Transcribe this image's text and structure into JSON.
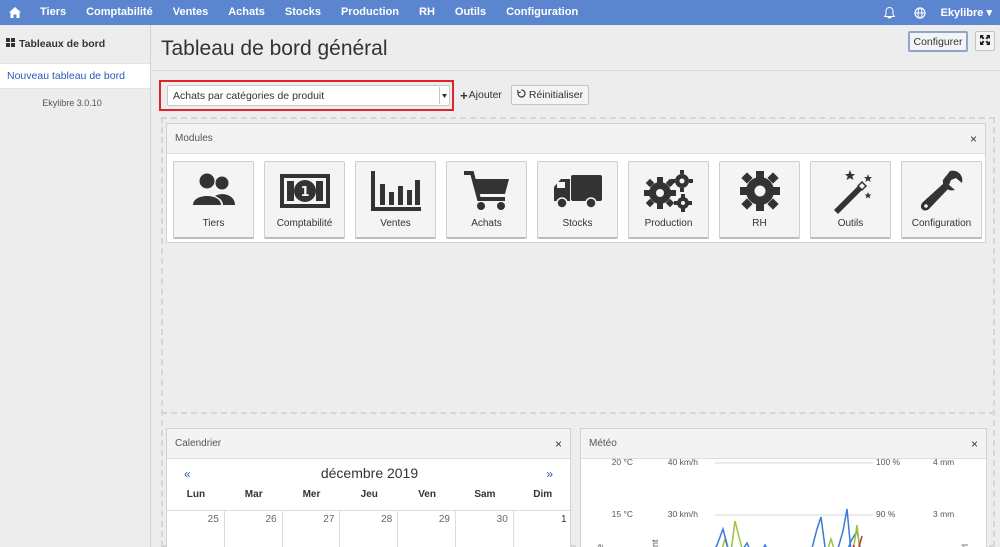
{
  "topbar": {
    "menu": [
      "Tiers",
      "Comptabilité",
      "Ventes",
      "Achats",
      "Stocks",
      "Production",
      "RH",
      "Outils",
      "Configuration"
    ],
    "user": "Ekylibre"
  },
  "sidebar": {
    "header": "Tableaux de bord",
    "item": "Nouveau tableau de bord",
    "version": "Ekylibre 3.0.10"
  },
  "page": {
    "title": "Tableau de bord général",
    "configure_label": "Configurer"
  },
  "toolbar": {
    "select_value": "Achats par catégories de produit",
    "add_label": "Ajouter",
    "reset_label": "Réinitialiser"
  },
  "modules": {
    "title": "Modules",
    "close": "×",
    "items": [
      {
        "label": "Tiers",
        "icon": "users-icon"
      },
      {
        "label": "Comptabilité",
        "icon": "banknote-icon"
      },
      {
        "label": "Ventes",
        "icon": "bar-chart-icon"
      },
      {
        "label": "Achats",
        "icon": "cart-icon"
      },
      {
        "label": "Stocks",
        "icon": "truck-icon"
      },
      {
        "label": "Production",
        "icon": "gears-icon"
      },
      {
        "label": "RH",
        "icon": "gear-icon"
      },
      {
        "label": "Outils",
        "icon": "magic-wand-icon"
      },
      {
        "label": "Configuration",
        "icon": "wrench-icon"
      }
    ]
  },
  "calendar": {
    "title": "Calendrier",
    "close": "×",
    "prev": "«",
    "next": "»",
    "month": "décembre 2019",
    "weekdays": [
      "Lun",
      "Mar",
      "Mer",
      "Jeu",
      "Ven",
      "Sam",
      "Dim"
    ],
    "first_row": [
      "25",
      "26",
      "27",
      "28",
      "29",
      "30",
      "1"
    ]
  },
  "meteo": {
    "title": "Météo",
    "close": "×",
    "axes": {
      "temp": [
        "20 °C",
        "15 °C"
      ],
      "wind": [
        "40 km/h",
        "30 km/h"
      ],
      "humidity": [
        "100 %",
        "90 %"
      ],
      "rain": [
        "4 mm",
        "3 mm"
      ]
    },
    "side_labels": [
      "re",
      "ent",
      "l",
      "Pl"
    ]
  },
  "colors": {
    "navbar": "#5b86cf",
    "link": "#2a5ab8",
    "highlight": "#e0222a"
  }
}
